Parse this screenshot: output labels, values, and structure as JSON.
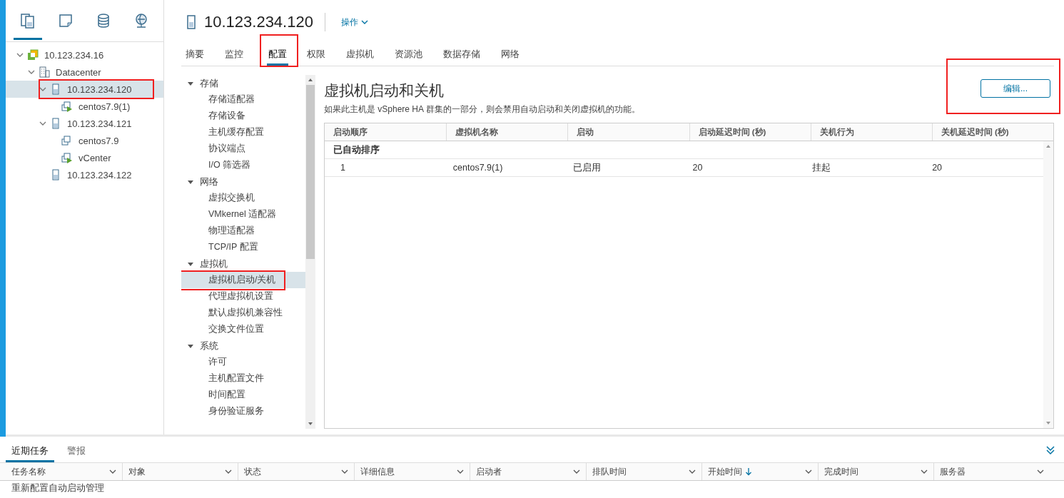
{
  "sidebar": {
    "view_tabs": [
      {
        "selected": true
      },
      {
        "selected": false
      },
      {
        "selected": false
      },
      {
        "selected": false
      }
    ],
    "tree": [
      {
        "label": "10.123.234.16",
        "kind": "vcenter",
        "expanded": true,
        "selected": false,
        "highlighted": false,
        "children": [
          {
            "label": "Datacenter",
            "kind": "datacenter",
            "expanded": true,
            "selected": false,
            "highlighted": false,
            "children": [
              {
                "label": "10.123.234.120",
                "kind": "host",
                "expanded": true,
                "selected": true,
                "highlighted": true,
                "children": [
                  {
                    "label": "centos7.9(1)",
                    "kind": "vm-on",
                    "selected": false,
                    "highlighted": false
                  }
                ]
              },
              {
                "label": "10.123.234.121",
                "kind": "host",
                "expanded": true,
                "selected": false,
                "highlighted": false,
                "children": [
                  {
                    "label": "centos7.9",
                    "kind": "vm-off",
                    "selected": false,
                    "highlighted": false
                  },
                  {
                    "label": "vCenter",
                    "kind": "vm-on",
                    "selected": false,
                    "highlighted": false
                  }
                ]
              },
              {
                "label": "10.123.234.122",
                "kind": "host",
                "selected": false,
                "highlighted": false
              }
            ]
          }
        ]
      }
    ]
  },
  "header": {
    "title": "10.123.234.120",
    "actions": "操作"
  },
  "tabs": [
    {
      "label": "摘要",
      "selected": false,
      "highlighted": false
    },
    {
      "label": "监控",
      "selected": false,
      "highlighted": false
    },
    {
      "label": "配置",
      "selected": true,
      "highlighted": true
    },
    {
      "label": "权限",
      "selected": false,
      "highlighted": false
    },
    {
      "label": "虚拟机",
      "selected": false,
      "highlighted": false
    },
    {
      "label": "资源池",
      "selected": false,
      "highlighted": false
    },
    {
      "label": "数据存储",
      "selected": false,
      "highlighted": false
    },
    {
      "label": "网络",
      "selected": false,
      "highlighted": false
    }
  ],
  "config_nav": [
    {
      "label": "存储",
      "expanded": true,
      "items": [
        {
          "label": "存储适配器",
          "selected": false,
          "highlighted": false
        },
        {
          "label": "存储设备",
          "selected": false,
          "highlighted": false
        },
        {
          "label": "主机缓存配置",
          "selected": false,
          "highlighted": false
        },
        {
          "label": "协议端点",
          "selected": false,
          "highlighted": false
        },
        {
          "label": "I/O 筛选器",
          "selected": false,
          "highlighted": false
        }
      ]
    },
    {
      "label": "网络",
      "expanded": true,
      "items": [
        {
          "label": "虚拟交换机",
          "selected": false,
          "highlighted": false
        },
        {
          "label": "VMkernel 适配器",
          "selected": false,
          "highlighted": false
        },
        {
          "label": "物理适配器",
          "selected": false,
          "highlighted": false
        },
        {
          "label": "TCP/IP 配置",
          "selected": false,
          "highlighted": false
        }
      ]
    },
    {
      "label": "虚拟机",
      "expanded": true,
      "items": [
        {
          "label": "虚拟机启动/关机",
          "selected": true,
          "highlighted": true
        },
        {
          "label": "代理虚拟机设置",
          "selected": false,
          "highlighted": false
        },
        {
          "label": "默认虚拟机兼容性",
          "selected": false,
          "highlighted": false
        },
        {
          "label": "交换文件位置",
          "selected": false,
          "highlighted": false
        }
      ]
    },
    {
      "label": "系统",
      "expanded": true,
      "items": [
        {
          "label": "许可",
          "selected": false,
          "highlighted": false
        },
        {
          "label": "主机配置文件",
          "selected": false,
          "highlighted": false
        },
        {
          "label": "时间配置",
          "selected": false,
          "highlighted": false
        },
        {
          "label": "身份验证服务",
          "selected": false,
          "highlighted": false
        }
      ]
    }
  ],
  "panel": {
    "title": "虚拟机启动和关机",
    "note": "如果此主机是 vSphere HA 群集的一部分，则会禁用自动启动和关闭虚拟机的功能。",
    "edit_button": {
      "label": "编辑...",
      "highlighted": true
    },
    "table": {
      "columns": [
        "启动顺序",
        "虚拟机名称",
        "启动",
        "启动延迟时间 (秒)",
        "关机行为",
        "关机延迟时间 (秒)"
      ],
      "groups": [
        {
          "label": "已自动排序",
          "rows": [
            [
              "1",
              "centos7.9(1)",
              "已启用",
              "20",
              "挂起",
              "20"
            ]
          ]
        }
      ]
    }
  },
  "recent_tasks": {
    "tabs": [
      {
        "label": "近期任务",
        "selected": true
      },
      {
        "label": "警报",
        "selected": false
      }
    ],
    "columns": [
      {
        "label": "任务名称",
        "sorted": false
      },
      {
        "label": "对象",
        "sorted": false
      },
      {
        "label": "状态",
        "sorted": false
      },
      {
        "label": "详细信息",
        "sorted": false
      },
      {
        "label": "启动者",
        "sorted": false
      },
      {
        "label": "排队时间",
        "sorted": false
      },
      {
        "label": "开始时间",
        "sorted": true
      },
      {
        "label": "完成时间",
        "sorted": false
      },
      {
        "label": "服务器",
        "sorted": false
      }
    ],
    "rows": [
      [
        "重新配置自动启动管理"
      ]
    ]
  }
}
